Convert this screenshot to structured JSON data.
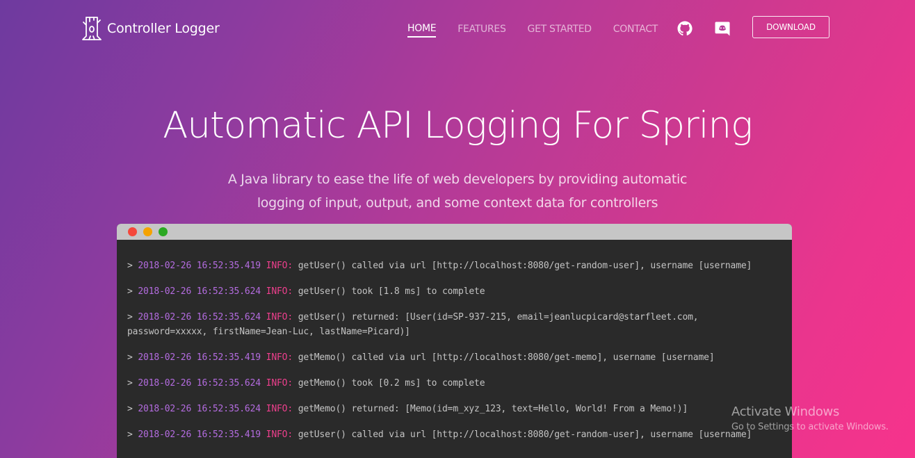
{
  "brand": {
    "name": "Controller Logger",
    "logo_icon": "tree-stump-logo-icon"
  },
  "nav": {
    "links": [
      {
        "label": "HOME",
        "active": true
      },
      {
        "label": "FEATURES",
        "active": false
      },
      {
        "label": "GET STARTED",
        "active": false
      },
      {
        "label": "CONTACT",
        "active": false
      }
    ],
    "icons": [
      "github-icon",
      "discord-icon"
    ],
    "download_label": "DOWNLOAD"
  },
  "hero": {
    "title": "Automatic API Logging For Spring",
    "subtitle_line1": "A Java library to ease the life of web developers by providing automatic",
    "subtitle_line2": "logging of input, output, and some context data for controllers"
  },
  "terminal": {
    "window_buttons": [
      "close",
      "minimize",
      "maximize"
    ],
    "lines": [
      {
        "prompt": ">",
        "timestamp": "2018-02-26 16:52:35.419",
        "level": "INFO:",
        "message": "getUser() called via url [http://localhost:8080/get-random-user], username [username]"
      },
      {
        "prompt": ">",
        "timestamp": "2018-02-26 16:52:35.624",
        "level": "INFO:",
        "message": "getUser() took [1.8 ms] to complete"
      },
      {
        "prompt": ">",
        "timestamp": "2018-02-26 16:52:35.624",
        "level": "INFO:",
        "message": "getUser() returned: [User(id=SP-937-215, email=jeanlucpicard@starfleet.com, password=xxxxx, firstName=Jean-Luc, lastName=Picard)]"
      },
      {
        "prompt": ">",
        "timestamp": "2018-02-26 16:52:35.419",
        "level": "INFO:",
        "message": "getMemo() called via url [http://localhost:8080/get-memo], username [username]"
      },
      {
        "prompt": ">",
        "timestamp": "2018-02-26 16:52:35.624",
        "level": "INFO:",
        "message": "getMemo() took [0.2 ms] to complete"
      },
      {
        "prompt": ">",
        "timestamp": "2018-02-26 16:52:35.624",
        "level": "INFO:",
        "message": "getMemo() returned: [Memo(id=m_xyz_123, text=Hello, World! From a Memo!)]"
      },
      {
        "prompt": ">",
        "timestamp": "2018-02-26 16:52:35.419",
        "level": "INFO:",
        "message": "getUser() called via url [http://localhost:8080/get-random-user], username [username]"
      }
    ]
  },
  "watermark": {
    "title": "Activate Windows",
    "subtitle": "Go to Settings to activate Windows."
  },
  "colors": {
    "gradient_start": "#6e3a9f",
    "gradient_end": "#f6338c",
    "terminal_bg": "#2a2a2a",
    "terminal_bar": "#c6c6c6",
    "timestamp": "#b46ce0",
    "level": "#ee3f8d",
    "log_text": "#c4c4c4"
  }
}
